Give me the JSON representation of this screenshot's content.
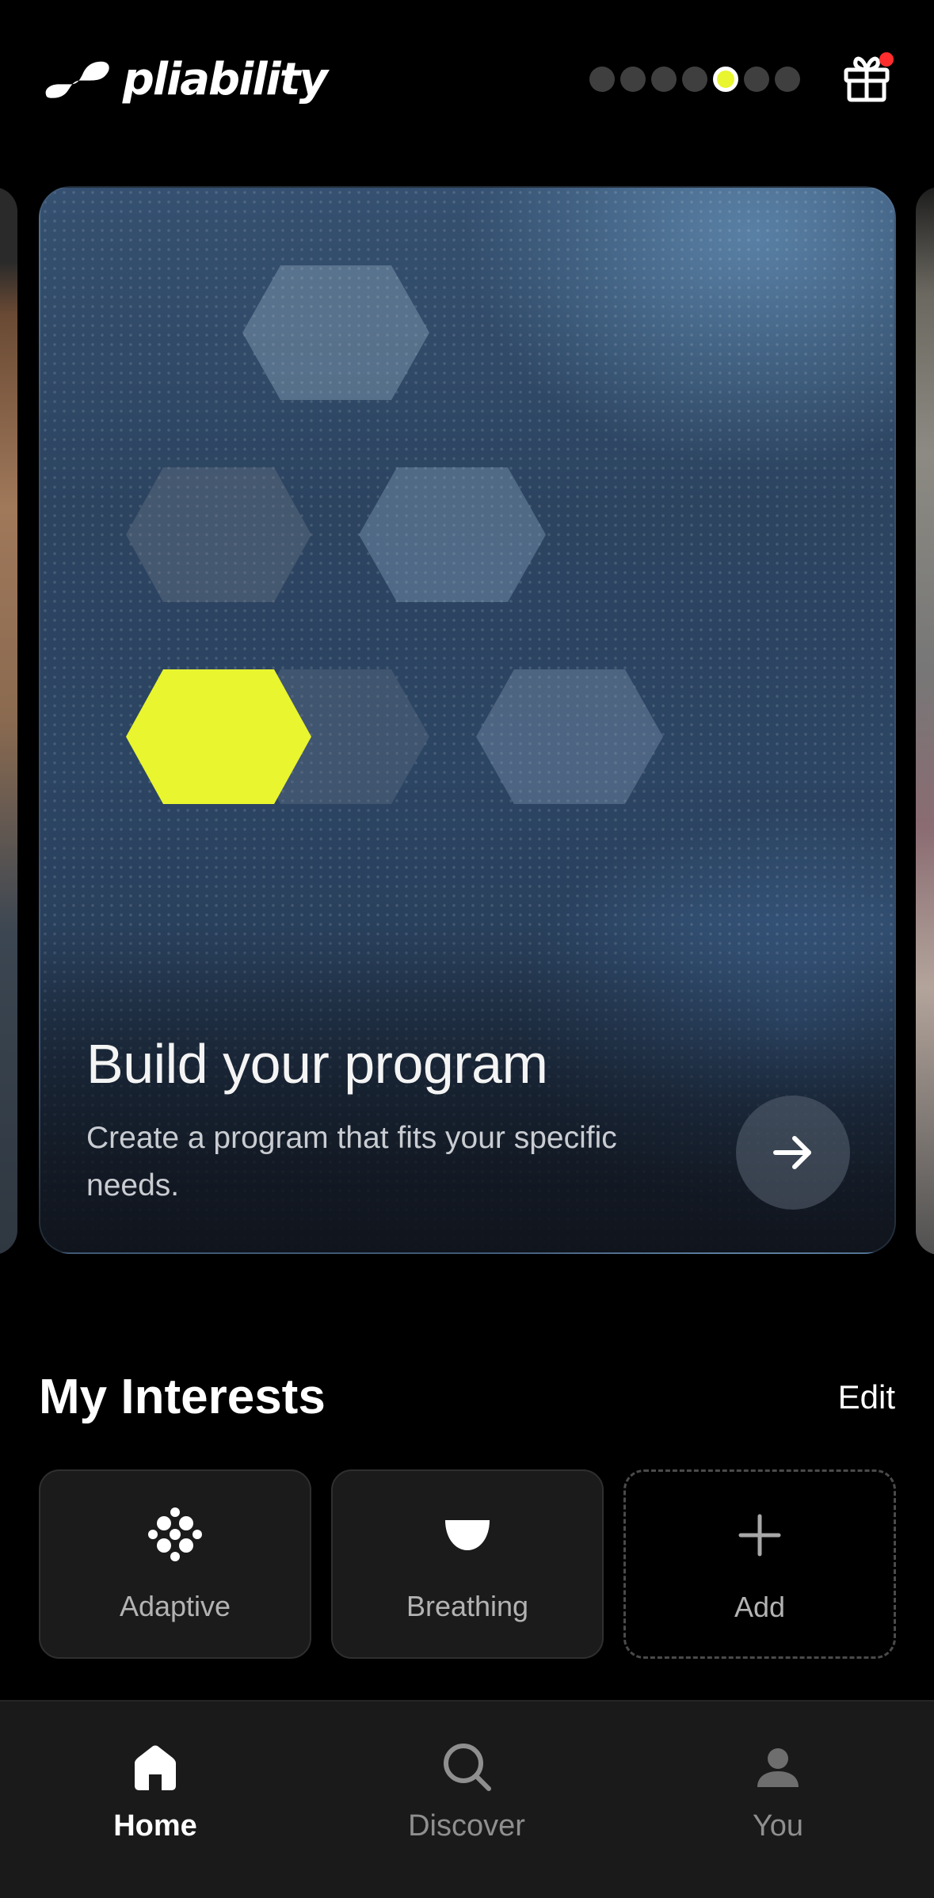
{
  "app": {
    "brand": "pliability"
  },
  "header": {
    "pager_count": 7,
    "pager_active_index": 4,
    "gift_icon": "gift-icon",
    "has_notification": true
  },
  "carousel": {
    "card": {
      "title": "Build your program",
      "subtitle": "Create a program that fits your specific needs.",
      "accent_color": "#e9f52e",
      "arrow_icon": "arrow-right-icon"
    }
  },
  "interests": {
    "title": "My Interests",
    "edit_label": "Edit",
    "items": [
      {
        "label": "Adaptive",
        "icon": "adaptive-icon"
      },
      {
        "label": "Breathing",
        "icon": "breathing-icon"
      },
      {
        "label": "Add",
        "icon": "plus-icon"
      }
    ]
  },
  "nav": {
    "items": [
      {
        "label": "Home",
        "icon": "home-icon",
        "active": true
      },
      {
        "label": "Discover",
        "icon": "search-icon",
        "active": false
      },
      {
        "label": "You",
        "icon": "user-icon",
        "active": false
      }
    ]
  }
}
